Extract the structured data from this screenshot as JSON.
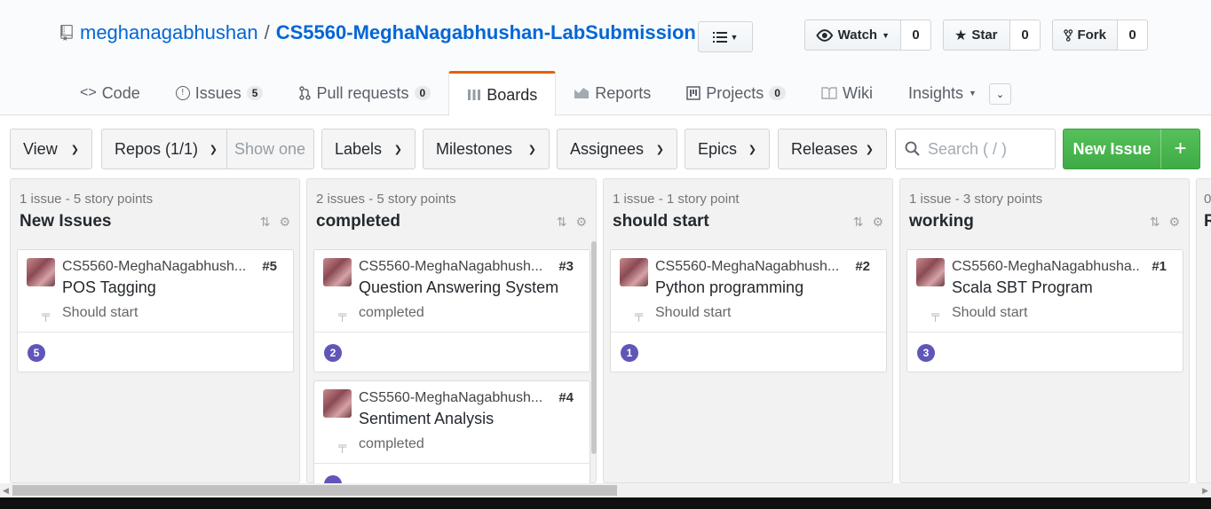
{
  "repo": {
    "owner": "meghanagabhushan",
    "separator": "/",
    "name": "CS5560-MeghaNagabhushan-LabSubmission"
  },
  "actions": {
    "watch": {
      "label": "Watch",
      "count": "0"
    },
    "star": {
      "label": "Star",
      "count": "0"
    },
    "fork": {
      "label": "Fork",
      "count": "0"
    }
  },
  "nav": {
    "code": "Code",
    "issues": "Issues",
    "issues_count": "5",
    "pulls": "Pull requests",
    "pulls_count": "0",
    "boards": "Boards",
    "reports": "Reports",
    "projects": "Projects",
    "projects_count": "0",
    "wiki": "Wiki",
    "insights": "Insights"
  },
  "toolbar": {
    "view": "View",
    "repos": "Repos (1/1)",
    "show_one": "Show one",
    "labels": "Labels",
    "milestones": "Milestones",
    "assignees": "Assignees",
    "epics": "Epics",
    "releases": "Releases",
    "search_placeholder": "Search ( / )",
    "new_issue": "New Issue",
    "plus": "+"
  },
  "pipelines": [
    {
      "meta_count": "1 issue",
      "meta_points": "- 5 story points",
      "name": "New Issues",
      "cards": [
        {
          "repo": "CS5560-MeghaNagabhush...",
          "number": "#5",
          "title": "POS Tagging",
          "pipeline": "Should start",
          "estimate": "5"
        }
      ]
    },
    {
      "meta_count": "2 issues",
      "meta_points": "- 5 story points",
      "name": "completed",
      "cards": [
        {
          "repo": "CS5560-MeghaNagabhush...",
          "number": "#3",
          "title": "Question Answering System",
          "pipeline": "completed",
          "estimate": "2"
        },
        {
          "repo": "CS5560-MeghaNagabhush...",
          "number": "#4",
          "title": "Sentiment Analysis",
          "pipeline": "completed",
          "estimate": ""
        }
      ]
    },
    {
      "meta_count": "1 issue",
      "meta_points": "- 1 story point",
      "name": "should start",
      "cards": [
        {
          "repo": "CS5560-MeghaNagabhush...",
          "number": "#2",
          "title": "Python programming",
          "pipeline": "Should start",
          "estimate": "1"
        }
      ]
    },
    {
      "meta_count": "1 issue",
      "meta_points": "- 3 story points",
      "name": "working",
      "cards": [
        {
          "repo": "CS5560-MeghaNagabhusha..",
          "number": "#1",
          "title": "Scala SBT Program",
          "pipeline": "Should start",
          "estimate": "3"
        }
      ]
    },
    {
      "meta_count": "0",
      "meta_points": "",
      "name": "R",
      "cards": []
    }
  ],
  "colors": {
    "link": "#0366d6",
    "accent": "#e36209",
    "estimate": "#6056b8",
    "new_issue": "#3fab45"
  }
}
